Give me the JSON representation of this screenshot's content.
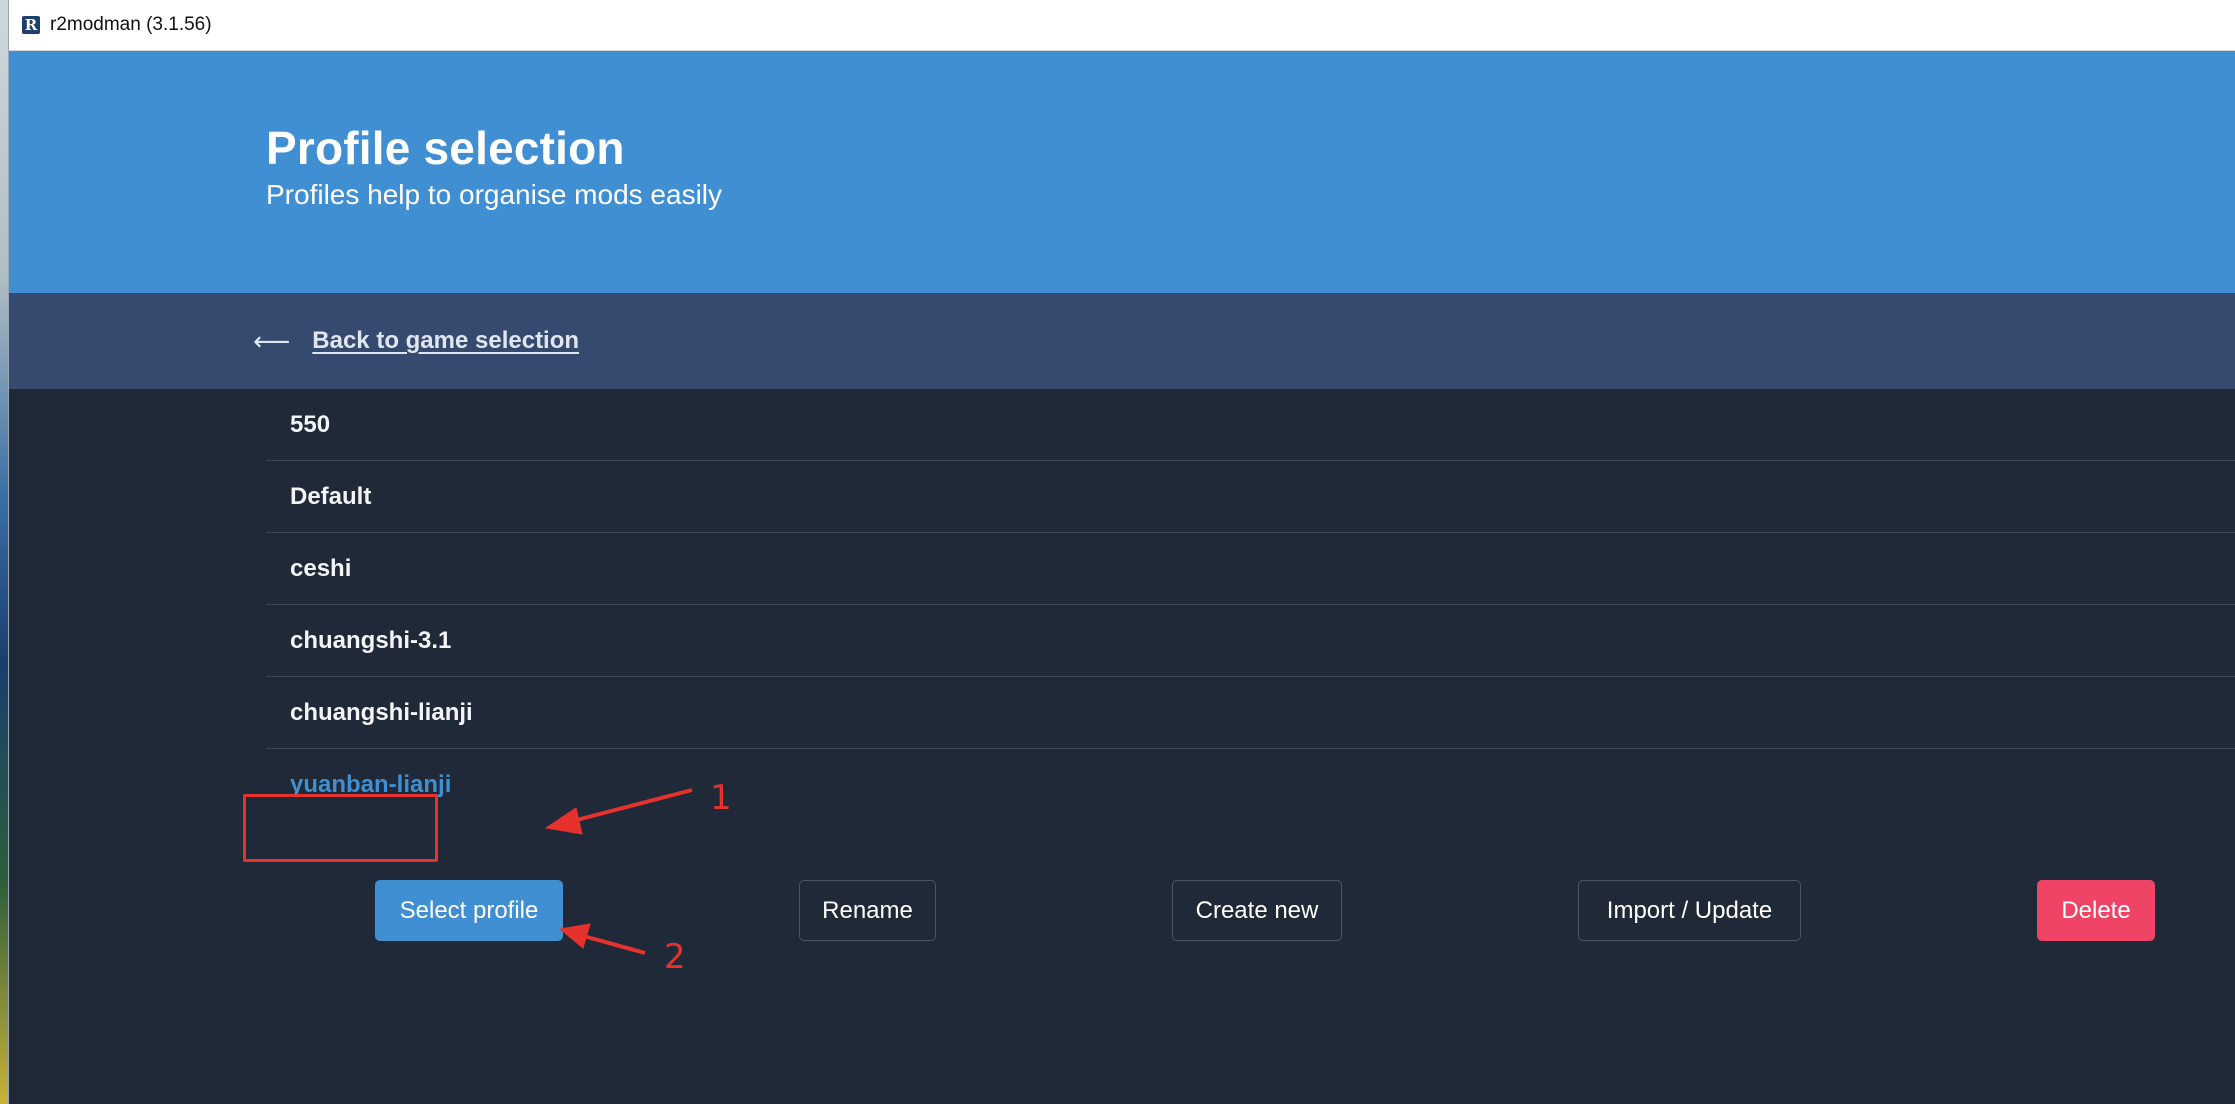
{
  "window": {
    "title": "r2modman (3.1.56)",
    "icon": "app-logo-icon",
    "icon_letter": "R"
  },
  "hero": {
    "title": "Profile selection",
    "subtitle": "Profiles help to organise mods easily"
  },
  "nav": {
    "back_arrow": "⟵",
    "back_label": "Back to game selection"
  },
  "profiles": [
    {
      "name": "550",
      "selected": false
    },
    {
      "name": "Default",
      "selected": false
    },
    {
      "name": "ceshi",
      "selected": false
    },
    {
      "name": "chuangshi-3.1",
      "selected": false
    },
    {
      "name": "chuangshi-lianji",
      "selected": false
    },
    {
      "name": "yuanban-lianji",
      "selected": true
    }
  ],
  "actions": {
    "select": "Select profile",
    "rename": "Rename",
    "create": "Create new",
    "import": "Import / Update",
    "delete": "Delete"
  },
  "annotations": {
    "step1": "1",
    "step2": "2"
  },
  "colors": {
    "primary": "#3f8fd2",
    "backbar": "#364a70",
    "background": "#1f2937",
    "danger": "#f04467",
    "annotation": "#e5322d"
  }
}
